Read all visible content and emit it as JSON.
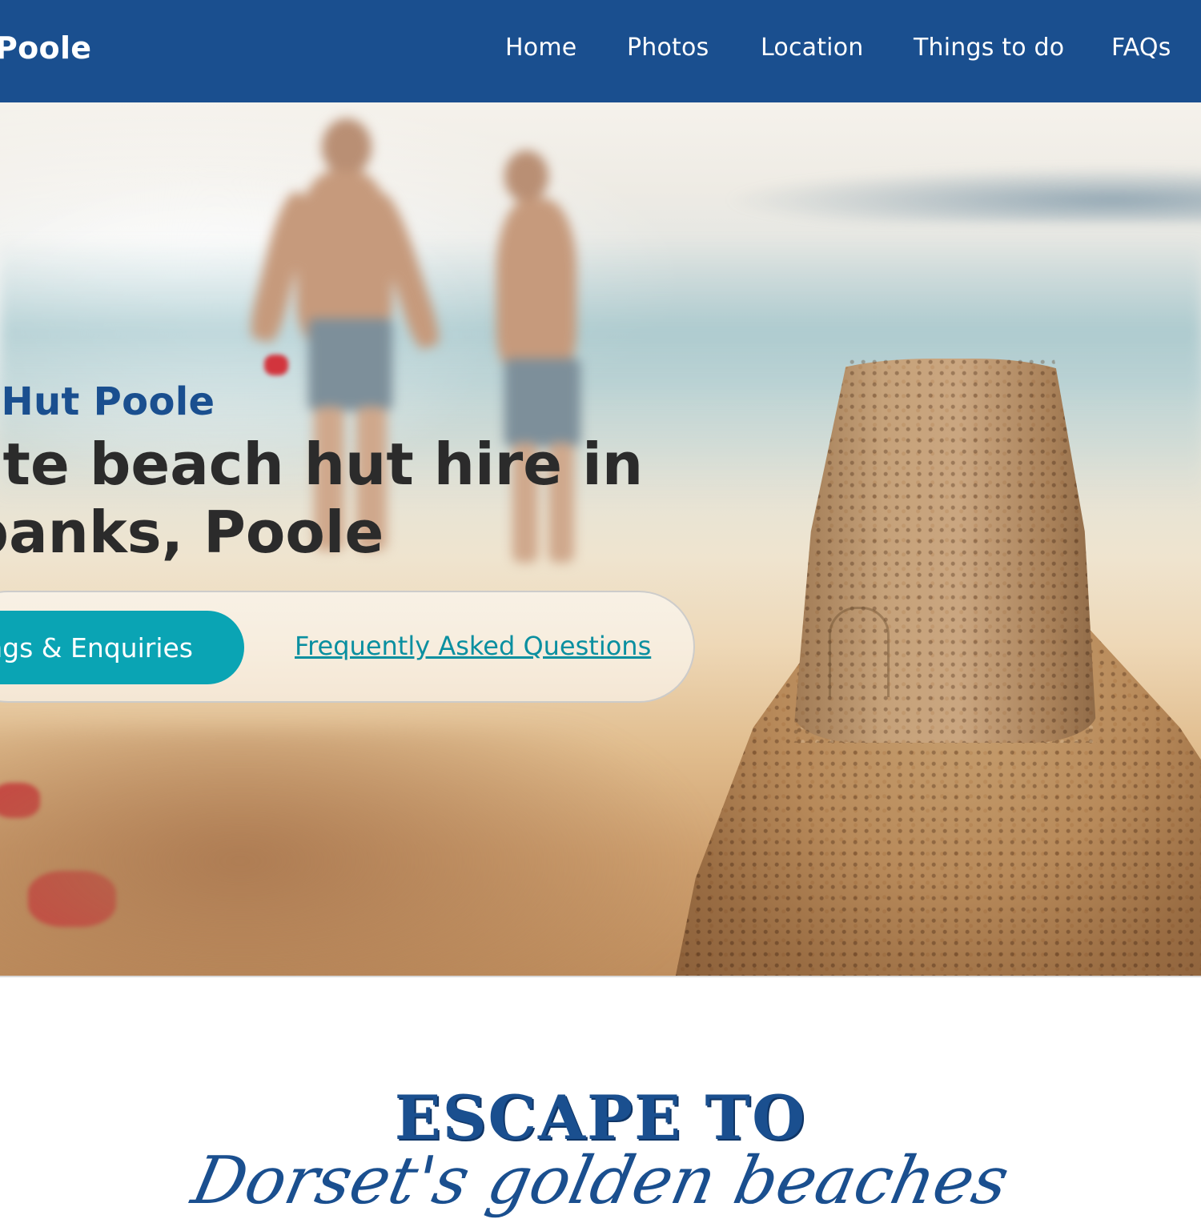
{
  "header": {
    "logo_text": "Poole",
    "nav": [
      {
        "label": "Home"
      },
      {
        "label": "Photos"
      },
      {
        "label": "Location"
      },
      {
        "label": "Things to do"
      },
      {
        "label": "FAQs"
      }
    ]
  },
  "hero": {
    "eyebrow": "h Hut Poole",
    "title_line1": "vate beach hut hire in",
    "title_line2": "dbanks, Poole",
    "primary_button": "ngs & Enquiries",
    "secondary_link": "Frequently Asked Questions"
  },
  "escape": {
    "heading": "ESCAPE TO",
    "script": "Dorset's golden beaches"
  },
  "colors": {
    "header_bg": "#1a4f8f",
    "accent_teal": "#0aa4b4",
    "link_teal": "#0a8fa0",
    "heading_dark": "#2b2b2b"
  }
}
